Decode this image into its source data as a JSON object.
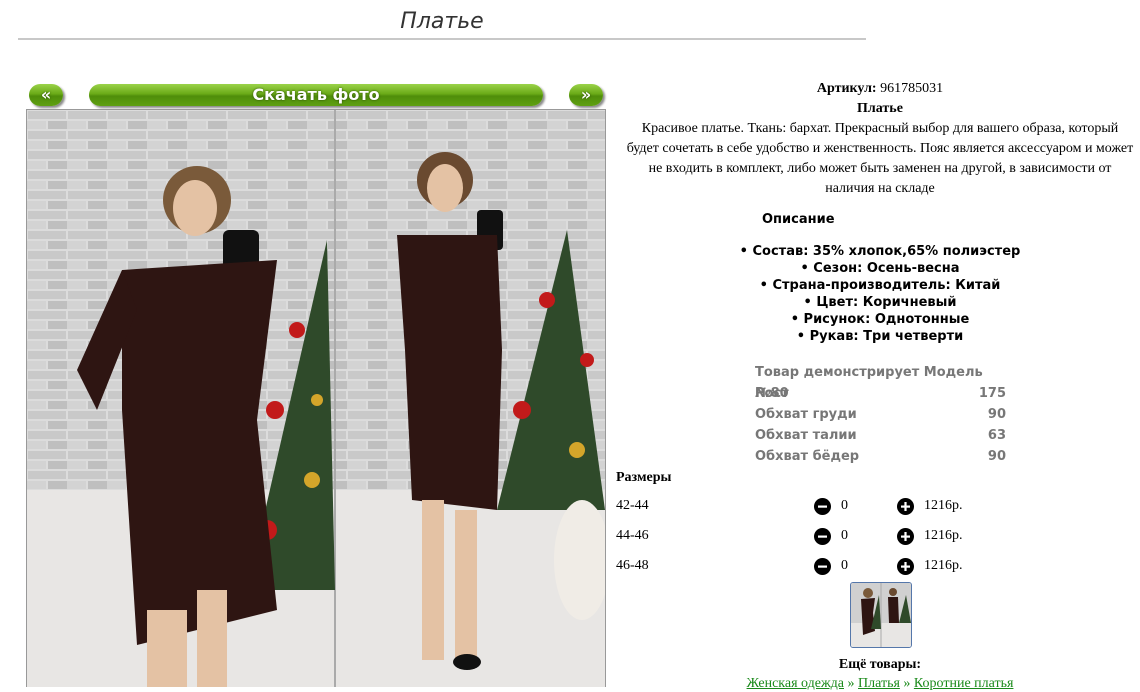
{
  "page": {
    "title": "Платье"
  },
  "nav": {
    "prev_label": "«",
    "download_label": "Скачать фото",
    "next_label": "»"
  },
  "product": {
    "article_label": "Артикул:",
    "article": "961785031",
    "name": "Платье",
    "description": "Красивое платье. Ткань: бархат. Прекрасный выбор для вашего образа, который будет сочетать в себе удобство и женственность. Пояс является аксессуаром и может не входить в комплект, либо может быть заменен на другой, в зависимости от наличия на складе"
  },
  "description_heading": "Описание",
  "properties": [
    "Состав: 35% хлопок,65% полиэстер",
    "Сезон: Осень-весна",
    "Страна-производитель: Китай",
    "Цвет: Коричневый",
    "Рисунок: Однотонные",
    "Рукав: Три четверти"
  ],
  "model": {
    "heading": "Товар демонстрирует Модель №80",
    "rows": [
      {
        "label": "Рост",
        "value": "175"
      },
      {
        "label": "Обхват груди",
        "value": "90"
      },
      {
        "label": "Обхват талии",
        "value": "63"
      },
      {
        "label": "Обхват бёдер",
        "value": "90"
      }
    ]
  },
  "sizes_heading": "Размеры",
  "sizes": [
    {
      "label": "42-44",
      "qty": "0",
      "price": "1216р."
    },
    {
      "label": "44-46",
      "qty": "0",
      "price": "1216р."
    },
    {
      "label": "46-48",
      "qty": "0",
      "price": "1216р."
    }
  ],
  "more_goods": "Ещё товары:",
  "breadcrumbs": [
    "Женская одежда",
    "Платья",
    "Коротние платья"
  ],
  "colors": {
    "accent_green": "#6aaa17",
    "link_green": "#1a8a1a",
    "dress": "#2e1512"
  }
}
